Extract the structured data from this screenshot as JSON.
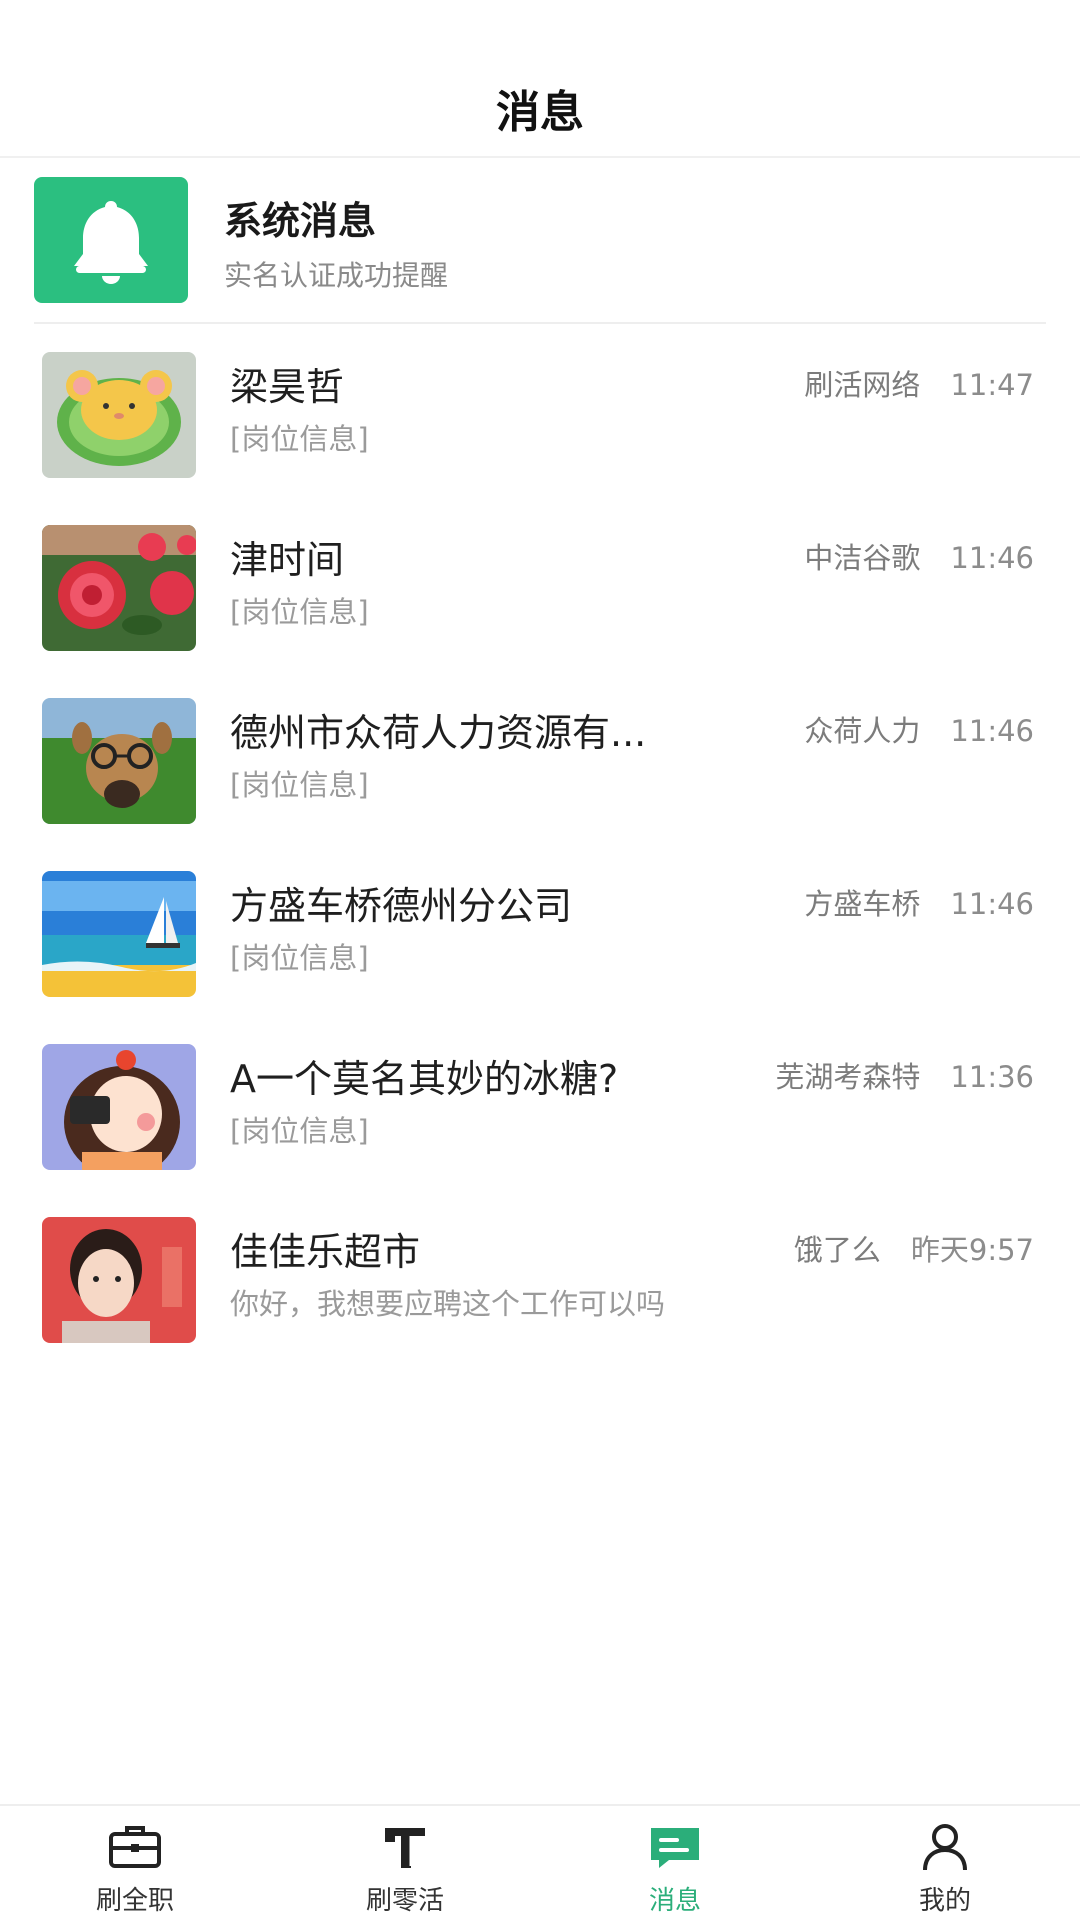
{
  "header": {
    "title": "消息"
  },
  "system_message": {
    "title": "系统消息",
    "subtitle": "实名认证成功提醒",
    "icon": "bell-icon",
    "color": "#2bbf80"
  },
  "chats": [
    {
      "name": "梁昊哲",
      "preview": "[岗位信息]",
      "company": "刷活网络",
      "time": "11:47",
      "avatar": "hamster-cartoon"
    },
    {
      "name": "津时间",
      "preview": "[岗位信息]",
      "company": "中洁谷歌",
      "time": "11:46",
      "avatar": "red-roses"
    },
    {
      "name": "德州市众荷人力资源有...",
      "preview": "[岗位信息]",
      "company": "众荷人力",
      "time": "11:46",
      "avatar": "dog-with-glasses"
    },
    {
      "name": "方盛车桥德州分公司",
      "preview": "[岗位信息]",
      "company": "方盛车桥",
      "time": "11:46",
      "avatar": "beach-sailboat"
    },
    {
      "name": "A一个莫名其妙的冰糖?",
      "preview": "[岗位信息]",
      "company": "芜湖考森特",
      "time": "11:36",
      "avatar": "cartoon-girl"
    },
    {
      "name": "佳佳乐超市",
      "preview": "你好，我想要应聘这个工作可以吗",
      "company": "饿了么",
      "time": "昨天9:57",
      "avatar": "young-man-red"
    }
  ],
  "tabbar": {
    "active_color": "#2bae7a",
    "items": [
      {
        "label": "刷全职",
        "icon": "briefcase-icon"
      },
      {
        "label": "刷零活",
        "icon": "t-tool-icon"
      },
      {
        "label": "消息",
        "icon": "message-icon",
        "active": true
      },
      {
        "label": "我的",
        "icon": "person-icon"
      }
    ]
  }
}
